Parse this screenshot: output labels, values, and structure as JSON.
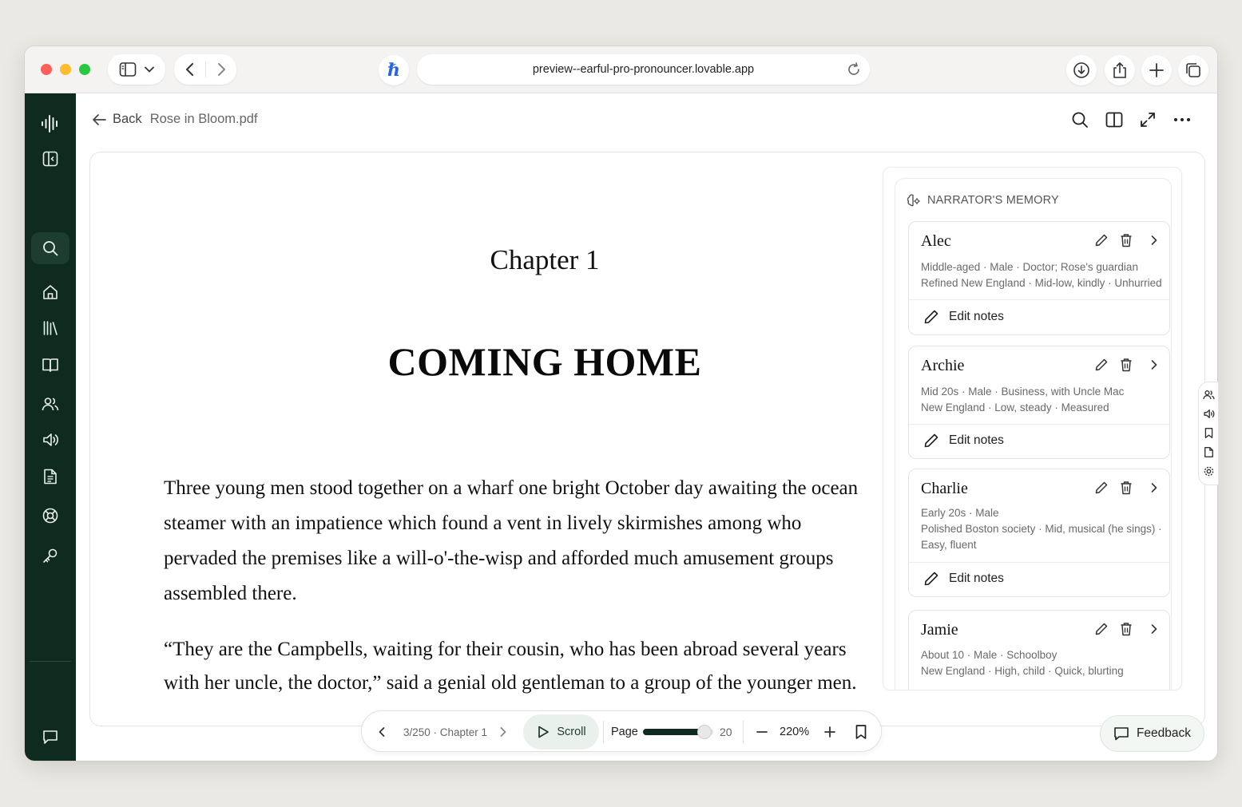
{
  "browser": {
    "url": "preview--earful-pro-pronouncer.lovable.app"
  },
  "header": {
    "back_label": "Back",
    "file_name": "Rose in Bloom.pdf"
  },
  "document": {
    "chapter_label": "Chapter 1",
    "chapter_title": "COMING HOME",
    "paragraphs": [
      "Three young men stood together on a wharf one bright October day awaiting the ocean steamer with an impatience which found a vent in lively skirmishes among who pervaded the premises like a will-o'-the-wisp and afforded much amusement groups assembled there.",
      "“They are the Campbells, waiting for their cousin, who has been abroad several years with her uncle, the doctor,” said a genial old gentleman to a group of the younger men."
    ]
  },
  "memory": {
    "heading": "NARRATOR'S MEMORY",
    "edit_notes_label": "Edit notes",
    "characters": [
      {
        "name": "Alec",
        "lines": [
          "Middle-aged · Male · Doctor; Rose's guardian",
          "Refined New England · Mid-low, kindly · Unhurried"
        ]
      },
      {
        "name": "Archie",
        "lines": [
          "Mid 20s · Male · Business, with Uncle Mac",
          "New England · Low, steady · Measured"
        ]
      },
      {
        "name": "Charlie",
        "lines": [
          "Early 20s · Male",
          "Polished Boston society · Mid, musical (he sings) ·",
          "Easy, fluent"
        ]
      },
      {
        "name": "Jamie",
        "lines": [
          "About 10 · Male · Schoolboy",
          "New England · High, child · Quick, blurting"
        ]
      }
    ]
  },
  "readbar": {
    "position": "3/250 · Chapter 1",
    "scroll_label": "Scroll",
    "page_label": "Page",
    "page_value": "20",
    "page_progress": 0.88,
    "zoom": "220%"
  },
  "feedback_label": "Feedback",
  "icons": {
    "sidebar": [
      "waveform-logo-icon",
      "sidebar-panel-icon",
      "search-icon",
      "home-icon",
      "library-icon",
      "book-icon",
      "users-icon",
      "speaker-icon",
      "document-icon",
      "lifebuoy-icon",
      "key-icon",
      "chat-icon",
      "logout-icon"
    ],
    "rail": [
      "users-icon",
      "speaker-icon",
      "bookmark-icon",
      "file-icon",
      "gear-icon"
    ]
  },
  "colors": {
    "sidebar": "#0f2b20",
    "accent_soft": "#eaf1ec"
  }
}
